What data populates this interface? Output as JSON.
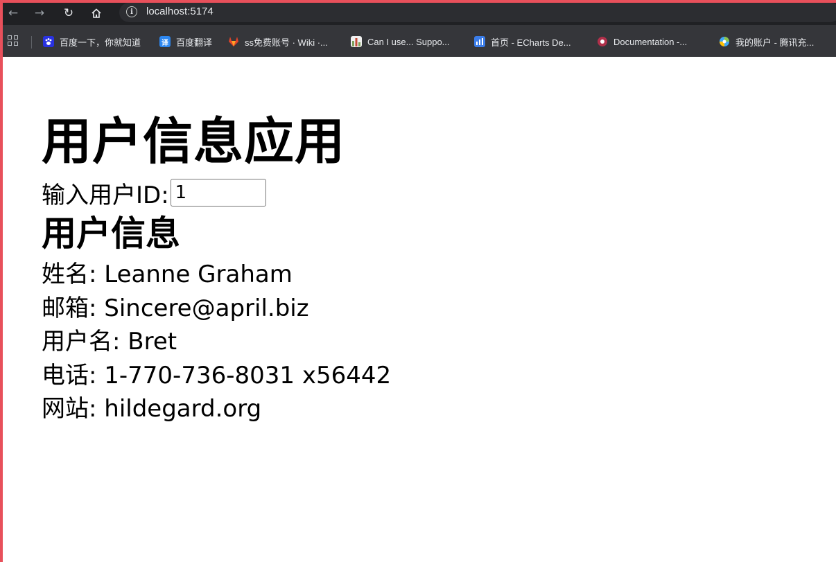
{
  "browser": {
    "url": "localhost:5174",
    "bookmarks": [
      {
        "label": "百度一下，你就知道",
        "icon": "baidu-paw-icon",
        "color": "#2932e1"
      },
      {
        "label": "百度翻译",
        "icon": "baidu-translate-icon",
        "color": "#2d87f0"
      },
      {
        "label": "ss免费账号 · Wiki ·...",
        "icon": "gitlab-fox-icon",
        "color": "#e24329"
      },
      {
        "label": "Can I use... Suppo...",
        "icon": "caniuse-chart-icon",
        "color": "#7ea15b"
      },
      {
        "label": "首页 - ECharts De...",
        "icon": "echarts-bar-icon",
        "color": "#3b7de9"
      },
      {
        "label": "Documentation -...",
        "icon": "documentation-circle-icon",
        "color": "#b0304a"
      },
      {
        "label": "我的账户 - 腾讯充...",
        "icon": "tencent-account-icon",
        "color": "#3fa7f5"
      }
    ]
  },
  "page": {
    "title": "用户信息应用",
    "input_label": "输入用户ID:",
    "user_id_value": "1",
    "section_title": "用户信息",
    "fields": [
      {
        "label": "姓名",
        "value": "Leanne Graham"
      },
      {
        "label": "邮箱",
        "value": "Sincere@april.biz"
      },
      {
        "label": "用户名",
        "value": "Bret"
      },
      {
        "label": "电话",
        "value": "1-770-736-8031 x56442"
      },
      {
        "label": "网站",
        "value": "hildegard.org"
      }
    ]
  }
}
